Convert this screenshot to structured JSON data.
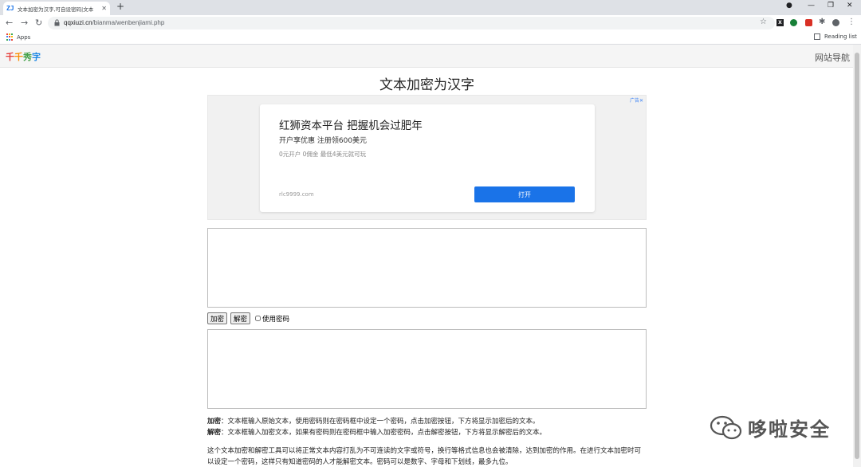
{
  "browser": {
    "tab_title": "文本加密为汉字,可自设密码|文本",
    "tab_favicon": "ZJ",
    "url_domain": "qqxiuzi.cn",
    "url_path": "/bianma/wenbenjiami.php",
    "bookmarks_apps": "Apps",
    "reading_list": "Reading list",
    "ext_x": "X"
  },
  "site": {
    "logo_chars": [
      "千",
      "千",
      "秀",
      "字"
    ],
    "nav_label": "网站导航"
  },
  "page": {
    "title": "文本加密为汉字"
  },
  "ad": {
    "flag": "广告✕",
    "title": "红狮资本平台 把握机会过肥年",
    "subtitle": "开户享优惠 注册领600美元",
    "small": "0元开户 0佣金 最低4美元就可玩",
    "domain": "rlc9999.com",
    "button": "打开"
  },
  "controls": {
    "encrypt_label": "加密",
    "decrypt_label": "解密",
    "use_password_label": "使用密码"
  },
  "description": {
    "encrypt_term": "加密",
    "encrypt_text": "：文本框输入原始文本，使用密码则在密码框中设定一个密码，点击加密按钮，下方将显示加密后的文本。",
    "decrypt_term": "解密",
    "decrypt_text": "：文本框输入加密文本，如果有密码则在密码框中输入加密密码，点击解密按钮，下方将显示解密后的文本。",
    "para": "这个文本加密和解密工具可以将正常文本内容打乱为不可连读的文字或符号，换行等格式信息也会被清除，达到加密的作用。在进行文本加密时可以设定一个密码，这样只有知道密码的人才能解密文本。密码可以是数字、字母和下划线，最多九位。"
  },
  "watermark": {
    "text": "哆啦安全"
  },
  "icons": {
    "back": "arrow-left-icon",
    "forward": "arrow-right-icon",
    "reload": "reload-icon",
    "lock": "lock-icon",
    "star": "star-icon",
    "menu": "kebab-icon"
  }
}
